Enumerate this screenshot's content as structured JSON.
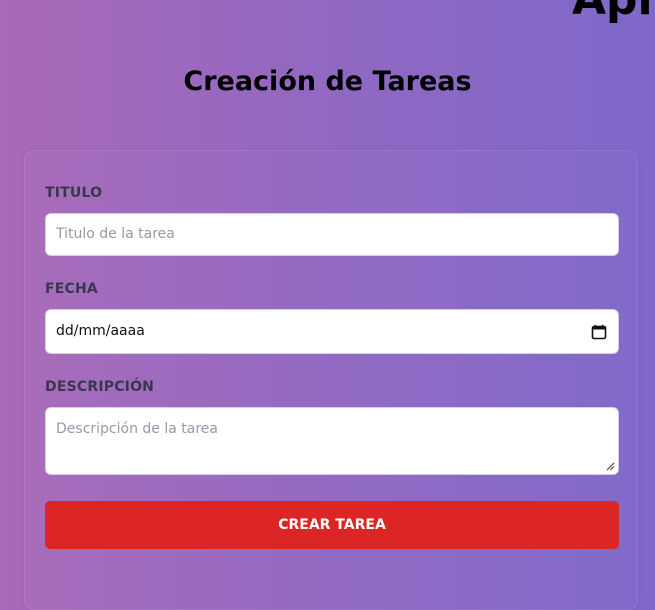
{
  "header": {
    "partial_title": "Apl"
  },
  "form": {
    "title": "Creación de Tareas",
    "titulo_label": "TITULO",
    "titulo_placeholder": "Titulo de la tarea",
    "fecha_label": "FECHA",
    "fecha_value": "dd/mm/aaaa",
    "descripcion_label": "DESCRIPCIÓN",
    "descripcion_placeholder": "Descripción de la tarea",
    "submit_label": "CREAR TAREA"
  },
  "icons": {
    "date": "calendar-icon",
    "resize": "resize-handle-icon"
  },
  "colors": {
    "button": "#dc2626",
    "background_start": "#a96ab8",
    "background_end": "#7e68c9"
  }
}
